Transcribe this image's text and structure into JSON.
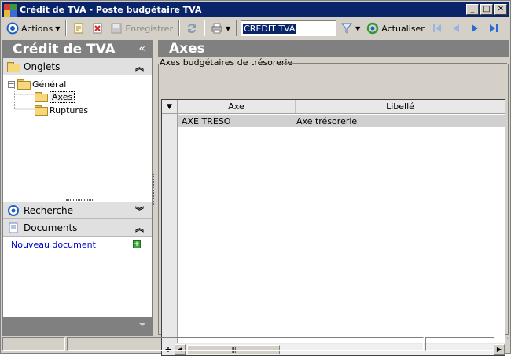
{
  "window": {
    "title": "Crédit de TVA - Poste budgétaire TVA",
    "controls": {
      "minimize": "_",
      "maximize": "□",
      "close": "✕"
    }
  },
  "toolbar": {
    "actions_label": "Actions",
    "save_label": "Enregistrer",
    "search_value": "CREDIT TVA",
    "refresh_label": "Actualiser"
  },
  "left_panel": {
    "title": "Crédit de TVA",
    "collapse_glyph": "«",
    "onglets_label": "Onglets",
    "tree": {
      "root": "Général",
      "children": [
        "Axes",
        "Ruptures"
      ]
    },
    "recherche_label": "Recherche",
    "documents_label": "Documents",
    "new_document_link": "Nouveau document"
  },
  "main": {
    "title": "Axes",
    "group_title": "Axes budgétaires de trésorerie",
    "columns": [
      "Axe",
      "Libellé"
    ],
    "rows": [
      {
        "axe": "AXE TRESO",
        "libelle": "Axe trésorerie"
      }
    ],
    "add_glyph": "+"
  },
  "colors": {
    "titlebar": "#0a246a",
    "panel_header": "#808080",
    "link": "#0000cc",
    "selected_row": "#d0d0d0"
  }
}
